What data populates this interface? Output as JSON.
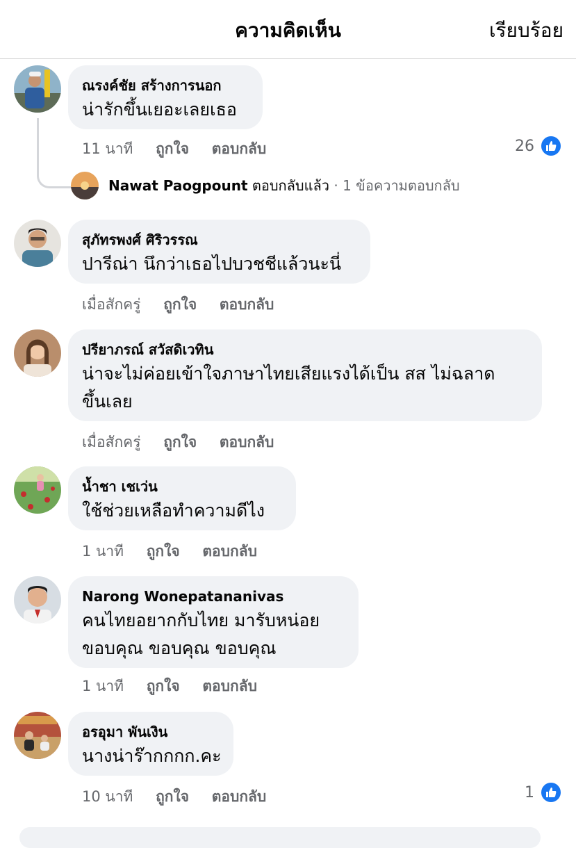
{
  "header": {
    "title": "ความคิดเห็น",
    "done_label": "เรียบร้อย"
  },
  "colors": {
    "accent": "#1877f2",
    "bubble": "#f0f2f5",
    "meta": "#65676b"
  },
  "comments": [
    {
      "author": "ณรงค์ชัย สร้างการนอก",
      "text": [
        "น่ารักขึ้นเยอะเลยเธอ"
      ],
      "time": "11 นาที",
      "like": "ถูกใจ",
      "reply": "ตอบกลับ",
      "reactions": "26",
      "replies_summary": {
        "name": "Nawat Paogpount",
        "action": "ตอบกลับแล้ว",
        "count": "· 1 ข้อความตอบกลับ"
      }
    },
    {
      "author": "สุภัทรพงศ์ ศิริวรรณ",
      "text": [
        "ปารีณ่า นึกว่าเธอไปบวชชีแล้วนะนี่"
      ],
      "time": "เมื่อสักครู่",
      "like": "ถูกใจ",
      "reply": "ตอบกลับ"
    },
    {
      "author": "ปรียาภรณ์ สวัสดิเวทิน",
      "text": [
        "น่าจะไม่ค่อยเข้าใจภาษาไทยเสียแรงได้เป็น สส ไม่ฉลาด",
        "ขึ้นเลย"
      ],
      "time": "เมื่อสักครู่",
      "like": "ถูกใจ",
      "reply": "ตอบกลับ"
    },
    {
      "author": "น้ำชา เชเว่น",
      "text": [
        "ใช้ช่วยเหลือทำความดีไง"
      ],
      "time": "1 นาที",
      "like": "ถูกใจ",
      "reply": "ตอบกลับ"
    },
    {
      "author": "Narong Wonepatananivas",
      "text": [
        "คนไทยอยากกับไทย มารับหน่อย",
        "ขอบคุณ ขอบคุณ ขอบคุณ"
      ],
      "time": "1 นาที",
      "like": "ถูกใจ",
      "reply": "ตอบกลับ"
    },
    {
      "author": "อรอุมา พันเงิน",
      "text": [
        "นางน่าร๊ากกกก.คะ"
      ],
      "time": "10 นาที",
      "like": "ถูกใจ",
      "reply": "ตอบกลับ",
      "reactions": "1"
    }
  ]
}
